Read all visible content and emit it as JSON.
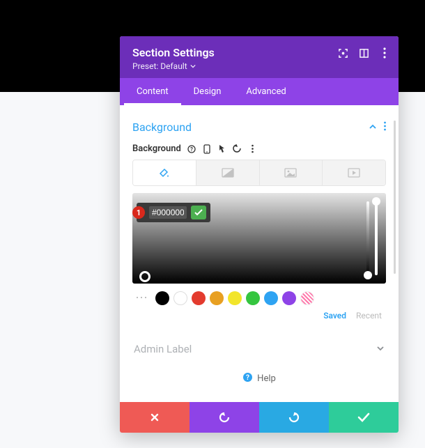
{
  "header": {
    "title": "Section Settings",
    "preset_label": "Preset: Default"
  },
  "tabs": [
    "Content",
    "Design",
    "Advanced"
  ],
  "active_tab": 0,
  "section": {
    "title": "Background",
    "row_label": "Background"
  },
  "bg_tabs": [
    "color",
    "gradient",
    "image",
    "video"
  ],
  "color": {
    "hex": "#000000",
    "callout": "1"
  },
  "swatches": [
    "#000000",
    "outline",
    "#e33b2e",
    "#e8a022",
    "#f2e52b",
    "#35c53f",
    "#2ea3f2",
    "#8e43e7",
    "hatched"
  ],
  "swatch_tabs": {
    "saved": "Saved",
    "recent": "Recent"
  },
  "admin": {
    "label": "Admin Label"
  },
  "help": {
    "label": "Help"
  }
}
